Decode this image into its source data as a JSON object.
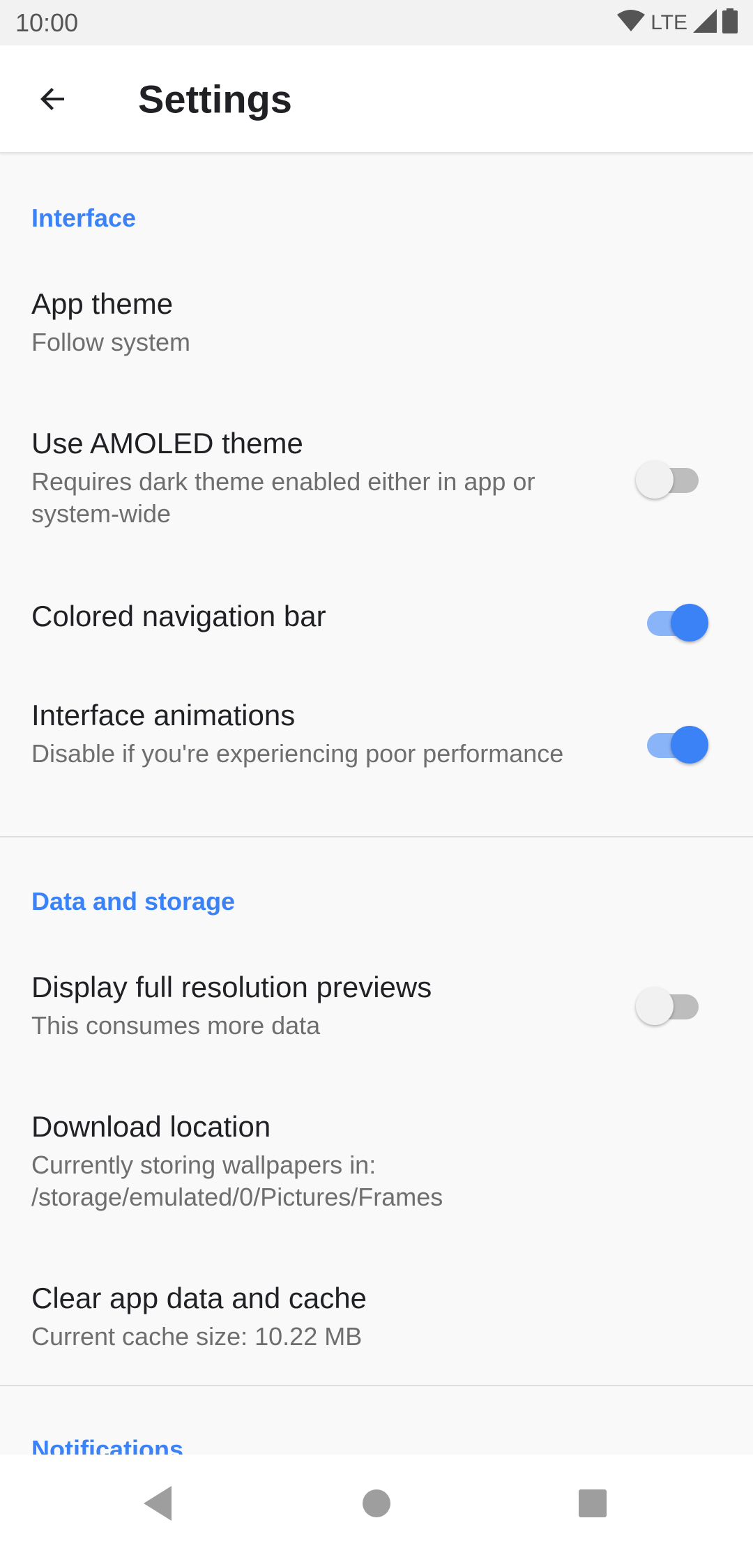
{
  "status_bar": {
    "time": "10:00",
    "network": "LTE",
    "icons": [
      "wifi-icon",
      "cell-signal-icon",
      "battery-icon"
    ]
  },
  "app_bar": {
    "title": "Settings",
    "back_icon": "arrow-back-icon"
  },
  "colors": {
    "accent": "#3b82f6",
    "accent_track": "#8ab4f8",
    "background": "#f9f9f9"
  },
  "sections": [
    {
      "header": "Interface",
      "items": [
        {
          "title": "App theme",
          "summary": "Follow system"
        },
        {
          "title": "Use AMOLED theme",
          "summary": "Requires dark theme enabled either in app or system-wide",
          "toggle": false
        },
        {
          "title": "Colored navigation bar",
          "toggle": true
        },
        {
          "title": "Interface animations",
          "summary": "Disable if you're experiencing poor performance",
          "toggle": true
        }
      ]
    },
    {
      "header": "Data and storage",
      "items": [
        {
          "title": "Display full resolution previews",
          "summary": "This consumes more data",
          "toggle": false
        },
        {
          "title": "Download location",
          "summary": "Currently storing wallpapers in:\n/storage/emulated/0/Pictures/Frames"
        },
        {
          "title": "Clear app data and cache",
          "summary": "Current cache size: 10.22 MB"
        }
      ]
    },
    {
      "header": "Notifications",
      "items": []
    }
  ],
  "nav_bar": {
    "icons": [
      "nav-back-icon",
      "nav-home-icon",
      "nav-recents-icon"
    ]
  }
}
